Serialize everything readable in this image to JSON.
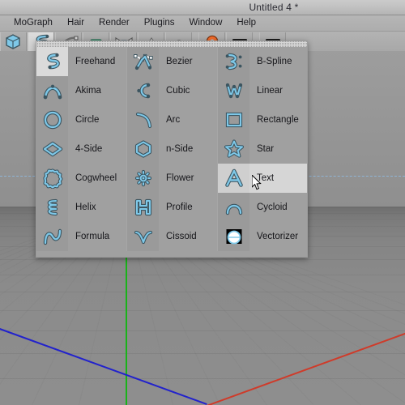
{
  "window": {
    "title": "Untitled 4 *"
  },
  "menubar": {
    "items": [
      {
        "label": "MoGraph",
        "name": "menu-mograph"
      },
      {
        "label": "Hair",
        "name": "menu-hair"
      },
      {
        "label": "Render",
        "name": "menu-render"
      },
      {
        "label": "Plugins",
        "name": "menu-plugins"
      },
      {
        "label": "Window",
        "name": "menu-window"
      },
      {
        "label": "Help",
        "name": "menu-help"
      }
    ]
  },
  "toolbar": {
    "buttons": [
      {
        "name": "cube-primitive-button",
        "icon": "cube-icon",
        "active": false
      },
      {
        "name": "spline-pen-button",
        "icon": "freehand-spline-icon",
        "active": true
      },
      {
        "name": "array-button",
        "icon": "nurbs-icon",
        "active": false
      },
      {
        "name": "deformer-button",
        "icon": "bend-deformer-icon",
        "active": false
      },
      {
        "name": "camera-button",
        "icon": "camera-icon",
        "active": false
      },
      {
        "name": "light-button",
        "icon": "light-icon",
        "active": false
      },
      {
        "name": "scene-button",
        "icon": "floor-icon",
        "active": false
      },
      {
        "name": "render-view-button",
        "icon": "render-sphere-icon",
        "active": false
      },
      {
        "name": "render-region-button",
        "icon": "render-bar-icon",
        "active": false
      },
      {
        "name": "render-settings-button",
        "icon": "render-settings-icon",
        "active": false
      }
    ]
  },
  "popup": {
    "name": "spline-primitives-palette",
    "columns": [
      {
        "name": "spline-column-1",
        "items": [
          {
            "label": "Freehand",
            "icon": "freehand-spline-icon",
            "highlighted": false,
            "source": true
          },
          {
            "label": "Akima",
            "icon": "akima-spline-icon",
            "highlighted": false,
            "source": false
          },
          {
            "label": "Circle",
            "icon": "circle-spline-icon",
            "highlighted": false,
            "source": false
          },
          {
            "label": "4-Side",
            "icon": "four-side-spline-icon",
            "highlighted": false,
            "source": false
          },
          {
            "label": "Cogwheel",
            "icon": "cogwheel-spline-icon",
            "highlighted": false,
            "source": false
          },
          {
            "label": "Helix",
            "icon": "helix-spline-icon",
            "highlighted": false,
            "source": false
          },
          {
            "label": "Formula",
            "icon": "formula-spline-icon",
            "highlighted": false,
            "source": false
          }
        ]
      },
      {
        "name": "spline-column-2",
        "items": [
          {
            "label": "Bezier",
            "icon": "bezier-spline-icon",
            "highlighted": false,
            "source": false
          },
          {
            "label": "Cubic",
            "icon": "cubic-spline-icon",
            "highlighted": false,
            "source": false
          },
          {
            "label": "Arc",
            "icon": "arc-spline-icon",
            "highlighted": false,
            "source": false
          },
          {
            "label": "n-Side",
            "icon": "n-side-spline-icon",
            "highlighted": false,
            "source": false
          },
          {
            "label": "Flower",
            "icon": "flower-spline-icon",
            "highlighted": false,
            "source": false
          },
          {
            "label": "Profile",
            "icon": "profile-spline-icon",
            "highlighted": false,
            "source": false
          },
          {
            "label": "Cissoid",
            "icon": "cissoid-spline-icon",
            "highlighted": false,
            "source": false
          }
        ]
      },
      {
        "name": "spline-column-3",
        "items": [
          {
            "label": "B-Spline",
            "icon": "b-spline-icon",
            "highlighted": false,
            "source": false
          },
          {
            "label": "Linear",
            "icon": "linear-spline-icon",
            "highlighted": false,
            "source": false
          },
          {
            "label": "Rectangle",
            "icon": "rectangle-spline-icon",
            "highlighted": false,
            "source": false
          },
          {
            "label": "Star",
            "icon": "star-spline-icon",
            "highlighted": false,
            "source": false
          },
          {
            "label": "Text",
            "icon": "text-spline-icon",
            "highlighted": true,
            "source": false
          },
          {
            "label": "Cycloid",
            "icon": "cycloid-spline-icon",
            "highlighted": false,
            "source": false
          },
          {
            "label": "Vectorizer",
            "icon": "vectorizer-icon",
            "highlighted": false,
            "source": false
          }
        ]
      }
    ]
  },
  "viewport": {
    "name": "perspective-viewport",
    "axes": {
      "y_color": "#19b319",
      "x_color": "#cf3b2a",
      "z_color": "#2222cc",
      "horizon_color": "#8fb6d8"
    }
  },
  "colors": {
    "chrome": "#b3b3b3",
    "popup_bg": "#a0a0a0",
    "highlight": "#d6d6d6",
    "icon_stroke": "#7ec8e8",
    "icon_dark": "#3c5560"
  }
}
